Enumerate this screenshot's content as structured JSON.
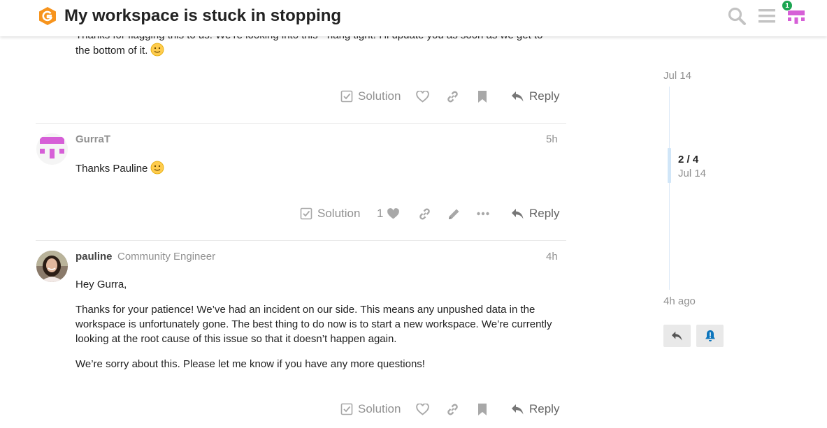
{
  "header": {
    "title": "My workspace is stuck in stopping",
    "notification_count": "1"
  },
  "posts": [
    {
      "text": "Thanks for flagging this to us. We’re looking into this - hang tight! I’ll update you as soon as we get to the bottom of it.",
      "emoji": "slight-smile",
      "actions": {
        "solution_label": "Solution",
        "reply_label": "Reply"
      }
    },
    {
      "username": "GurraT",
      "date": "5h",
      "text": "Thanks Pauline",
      "emoji": "slight-smile",
      "like_count": "1",
      "actions": {
        "solution_label": "Solution",
        "reply_label": "Reply"
      }
    },
    {
      "username": "pauline",
      "user_title": "Community Engineer",
      "date": "4h",
      "paragraphs": [
        "Hey Gurra,",
        "Thanks for your patience! We’ve had an incident on our side. This means any unpushed data in the workspace is unfortunately gone. The best thing to do now is to start a new workspace. We’re currently looking at the root cause of this issue so that it doesn’t happen again.",
        "We’re sorry about this. Please let me know if you have any more questions!"
      ],
      "actions": {
        "solution_label": "Solution",
        "reply_label": "Reply"
      }
    }
  ],
  "timeline": {
    "start_date": "Jul 14",
    "position": "2 / 4",
    "position_date": "Jul 14",
    "end_date": "4h ago"
  },
  "colors": {
    "brand_orange": "#f7941d",
    "avatar_magenta": "#d65fd7",
    "muted": "#919191",
    "notify_blue": "#0e76bd"
  }
}
